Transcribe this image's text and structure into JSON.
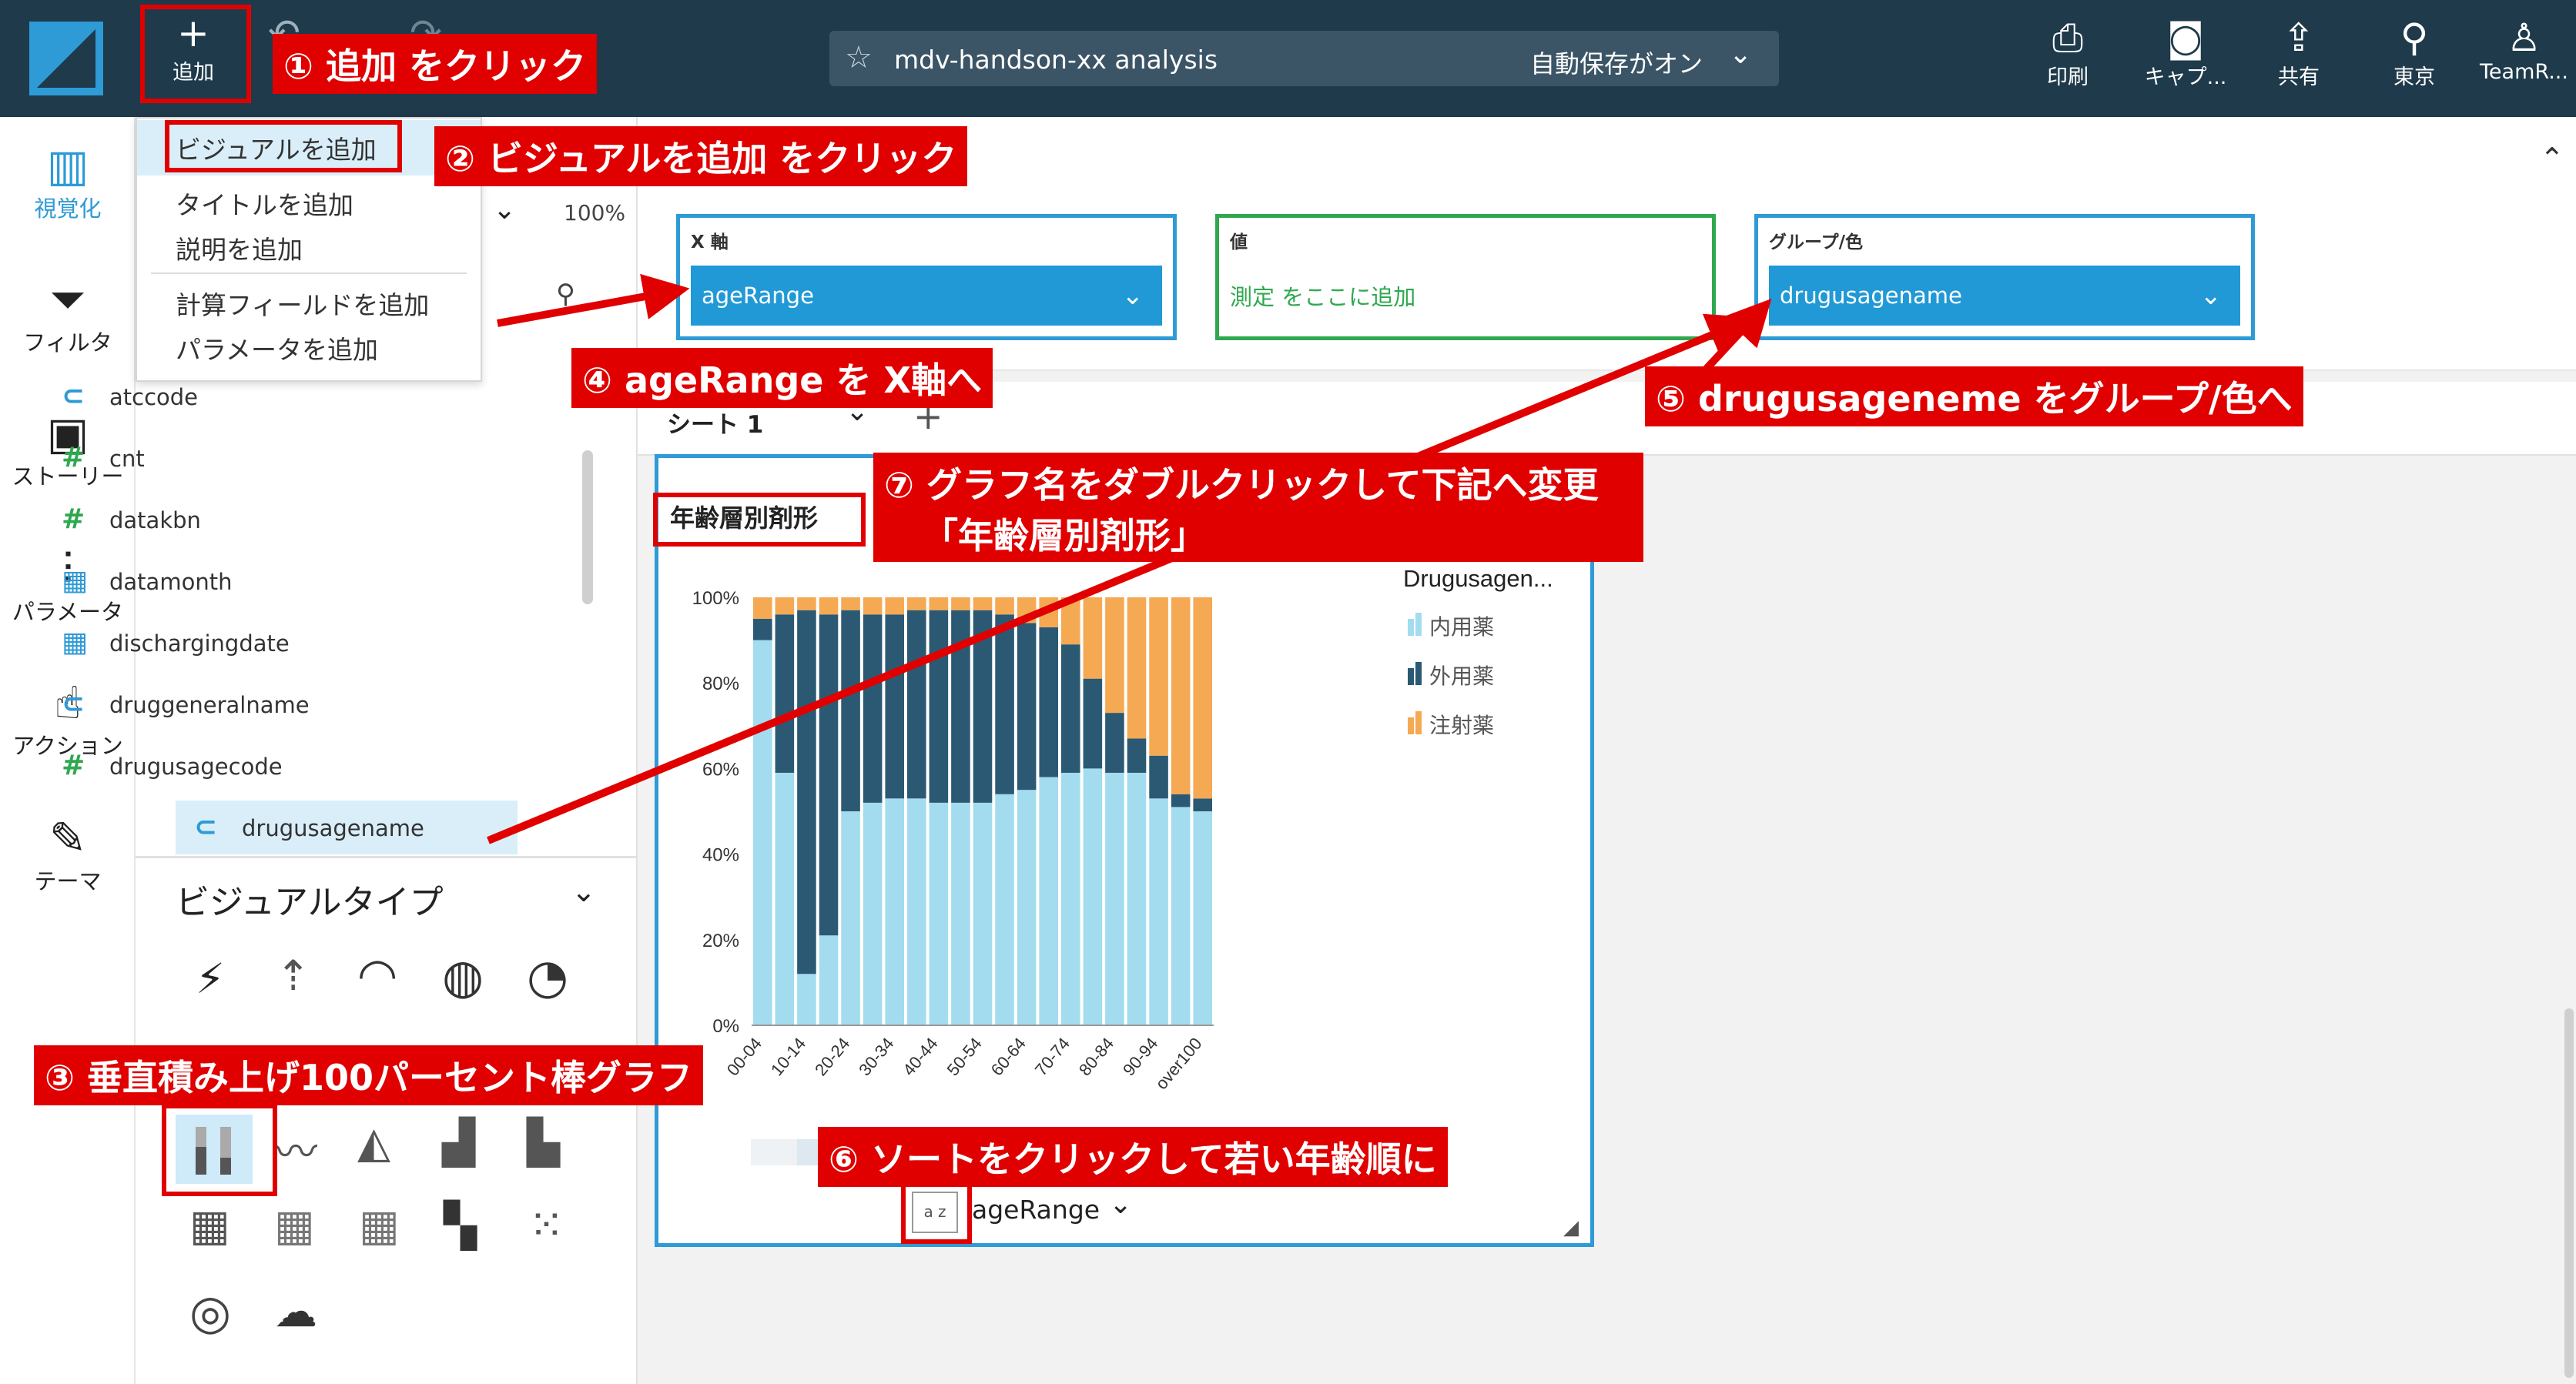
{
  "header": {
    "add_label": "追加",
    "undo_partial_label": "元",
    "analysis_title": "mdv-handson-xx analysis",
    "autosave_label": "自動保存がオン",
    "print_label": "印刷",
    "capture_label": "キャプ...",
    "share_label": "共有",
    "region_label": "東京",
    "team_label": "TeamR..."
  },
  "rail": {
    "visualize": "視覚化",
    "filter": "フィルタ",
    "story": "ストーリー",
    "parameter": "パラメータ",
    "action": "アクション",
    "theme": "テーマ"
  },
  "menu": {
    "items": [
      "ビジュアルを追加",
      "タイトルを追加",
      "説明を追加",
      "計算フィールドを追加",
      "パラメータを追加"
    ]
  },
  "panel": {
    "zoom": "100%",
    "fields": [
      {
        "name": "atccode",
        "type": "dim"
      },
      {
        "name": "cnt",
        "type": "measure"
      },
      {
        "name": "datakbn",
        "type": "measure"
      },
      {
        "name": "datamonth",
        "type": "date"
      },
      {
        "name": "dischargingdate",
        "type": "date"
      },
      {
        "name": "druggeneralname",
        "type": "dim"
      },
      {
        "name": "drugusagecode",
        "type": "measure"
      },
      {
        "name": "drugusagename",
        "type": "dim"
      }
    ],
    "visual_types_title": "ビジュアルタイプ"
  },
  "wells": {
    "x_axis_label": "X 軸",
    "x_axis_value": "ageRange",
    "value_label": "値",
    "value_placeholder": "測定 をここに追加",
    "group_label": "グループ/色",
    "group_value": "drugusagename"
  },
  "sheet": {
    "tab_label": "シート 1"
  },
  "visual": {
    "title": "年齢層別剤形",
    "sort_icon_text": "a z",
    "x_field_label": "ageRange"
  },
  "annotations": {
    "step1": "① 追加 をクリック",
    "step2": "② ビジュアルを追加 をクリック",
    "step3": "③ 垂直積み上げ100パーセント棒グラフ",
    "step4": "④ ageRange を X軸へ",
    "step5": "⑤ drugusageneme をグループ/色へ",
    "step6": "⑥ ソートをクリックして若い年齢順に",
    "step7_line1": "⑦ グラフ名をダブルクリックして下記へ変更",
    "step7_line2": "「年齢層別剤形」"
  },
  "colors": {
    "header_bg": "#1e3a4b",
    "accent_blue": "#2e9ad6",
    "annotation_red": "#e00000",
    "series_inner": "#a3dcef",
    "series_outer": "#2b5973",
    "series_injection": "#f5a953"
  },
  "chart_data": {
    "type": "bar",
    "stacked_percent": true,
    "categories": [
      "00-04",
      "05-09",
      "10-14",
      "15-19",
      "20-24",
      "25-29",
      "30-34",
      "35-39",
      "40-44",
      "45-49",
      "50-54",
      "55-59",
      "60-64",
      "65-69",
      "70-74",
      "75-79",
      "80-84",
      "85-89",
      "90-94",
      "95-99",
      "over100"
    ],
    "tick_labels": [
      "00-04",
      "10-14",
      "20-24",
      "30-34",
      "40-44",
      "50-54",
      "60-64",
      "70-74",
      "80-84",
      "90-94",
      "over100"
    ],
    "legend_title": "Drugusagen...",
    "series": [
      {
        "name": "内用薬",
        "values": [
          90,
          59,
          12,
          21,
          50,
          52,
          53,
          53,
          52,
          52,
          52,
          54,
          55,
          58,
          59,
          60,
          59,
          59,
          53,
          51,
          50
        ]
      },
      {
        "name": "外用薬",
        "values": [
          5,
          37,
          85,
          75,
          47,
          44,
          43,
          44,
          45,
          45,
          45,
          42,
          39,
          35,
          30,
          21,
          14,
          8,
          10,
          3,
          3
        ]
      },
      {
        "name": "注射薬",
        "values": [
          5,
          4,
          3,
          4,
          3,
          4,
          4,
          3,
          3,
          3,
          3,
          4,
          6,
          7,
          11,
          19,
          27,
          33,
          37,
          46,
          47
        ]
      }
    ],
    "yticks": [
      "0%",
      "20%",
      "40%",
      "60%",
      "80%",
      "100%"
    ],
    "ylim": [
      0,
      100
    ],
    "legend_position": "right"
  }
}
